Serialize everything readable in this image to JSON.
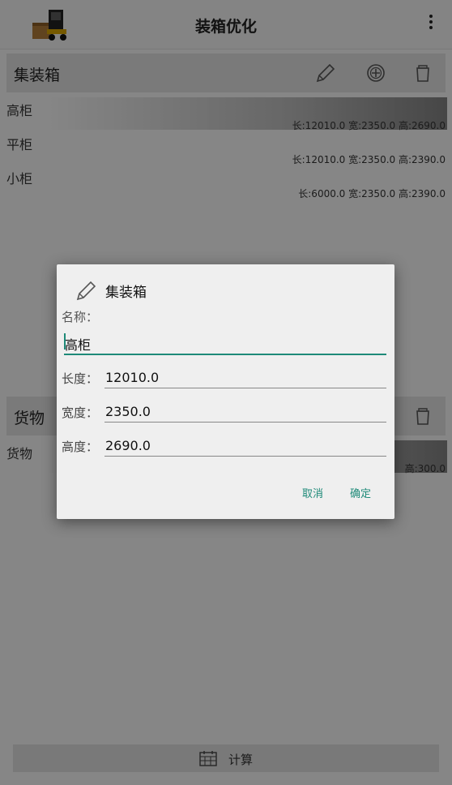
{
  "header": {
    "title": "装箱优化"
  },
  "containers": {
    "title": "集装箱",
    "items": [
      {
        "name": "高柜",
        "dims": "长:12010.0  宽:2350.0  高:2690.0"
      },
      {
        "name": "平柜",
        "dims": "长:12010.0  宽:2350.0  高:2390.0"
      },
      {
        "name": "小柜",
        "dims": "长:6000.0  宽:2350.0  高:2390.0"
      }
    ]
  },
  "goods": {
    "title": "货物",
    "items": [
      {
        "name": "货物",
        "dims": "高:300.0"
      }
    ]
  },
  "calc_label": "计算",
  "dialog": {
    "title": "集装箱",
    "name_label": "名称：",
    "name_value": "高柜",
    "length_label": "长度：",
    "length_value": "12010.0",
    "width_label": "宽度：",
    "width_value": "2350.0",
    "height_label": "高度：",
    "height_value": "2690.0",
    "cancel": "取消",
    "ok": "确定"
  }
}
